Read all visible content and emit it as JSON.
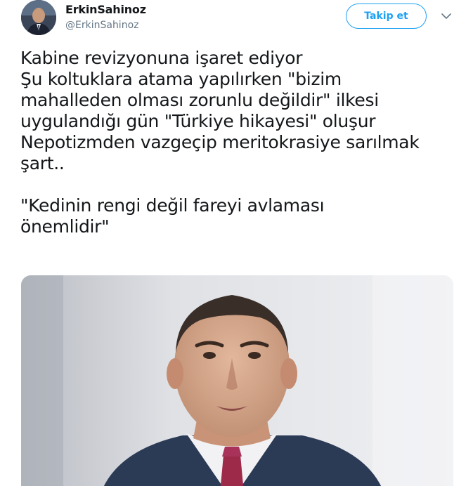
{
  "user": {
    "display_name": "ErkinSahinoz",
    "handle": "@ErkinSahinoz"
  },
  "follow_button": {
    "label": "Takip et"
  },
  "menu": {
    "icon": "chevron-down-icon"
  },
  "tweet": {
    "lines": [
      "Kabine revizyonuna işaret ediyor",
      "Şu koltuklara atama yapılırken \"bizim",
      "mahalleden olması zorunlu değildir\" ilkesi",
      "uygulandığı gün \"Türkiye hikayesi\" oluşur",
      "Nepotizmden vazgeçip meritokrasiye sarılmak",
      "şart..",
      "",
      "\"Kedinin rengi değil fareyi avlaması",
      "önemlidir\""
    ]
  },
  "colors": {
    "accent": "#1da1f2",
    "text": "#14171a",
    "secondary_text": "#657786"
  }
}
